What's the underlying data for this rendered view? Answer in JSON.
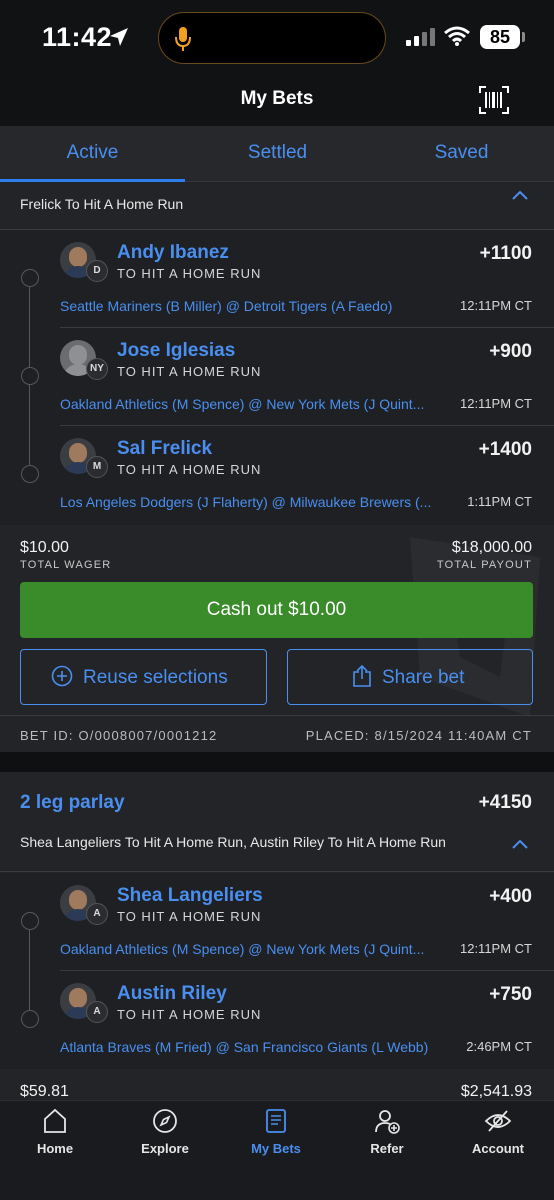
{
  "status": {
    "time": "11:42",
    "battery": "85"
  },
  "header": {
    "title": "My Bets"
  },
  "tabs": [
    {
      "label": "Active",
      "active": true
    },
    {
      "label": "Settled",
      "active": false
    },
    {
      "label": "Saved",
      "active": false
    }
  ],
  "bet1": {
    "description_tail": "Frelick To Hit A Home Run",
    "legs": [
      {
        "player": "Andy Ibanez",
        "market": "TO HIT A HOME RUN",
        "odds": "+1100",
        "team_logo": "D",
        "game": "Seattle Mariners (B Miller) @ Detroit Tigers (A Faedo)",
        "time": "12:11PM CT"
      },
      {
        "player": "Jose Iglesias",
        "market": "TO HIT A HOME RUN",
        "odds": "+900",
        "team_logo": "NY",
        "game": "Oakland Athletics (M Spence) @ New York Mets (J Quint...",
        "time": "12:11PM CT"
      },
      {
        "player": "Sal Frelick",
        "market": "TO HIT A HOME RUN",
        "odds": "+1400",
        "team_logo": "M",
        "game": "Los Angeles Dodgers (J Flaherty) @ Milwaukee Brewers (...",
        "time": "1:11PM CT"
      }
    ],
    "total_wager": "$10.00",
    "total_wager_label": "TOTAL WAGER",
    "total_payout": "$18,000.00",
    "total_payout_label": "TOTAL PAYOUT",
    "cashout_label": "Cash out $10.00",
    "reuse_label": "Reuse selections",
    "share_label": "Share bet",
    "bet_id": "BET ID: O/0008007/0001212",
    "placed": "PLACED: 8/15/2024 11:40AM CT"
  },
  "bet2": {
    "title": "2 leg parlay",
    "odds": "+4150",
    "description": "Shea Langeliers To Hit A Home Run, Austin Riley To Hit A Home Run",
    "legs": [
      {
        "player": "Shea Langeliers",
        "market": "TO HIT A HOME RUN",
        "odds": "+400",
        "team_logo": "A",
        "game": "Oakland Athletics (M Spence) @ New York Mets (J Quint...",
        "time": "12:11PM CT"
      },
      {
        "player": "Austin Riley",
        "market": "TO HIT A HOME RUN",
        "odds": "+750",
        "team_logo": "A",
        "game": "Atlanta Braves (M Fried) @ San Francisco Giants (L Webb)",
        "time": "2:46PM CT"
      }
    ],
    "total_wager": "$59.81",
    "total_payout": "$2,541.93"
  },
  "nav": [
    {
      "label": "Home",
      "icon": "home-icon"
    },
    {
      "label": "Explore",
      "icon": "compass-icon"
    },
    {
      "label": "My Bets",
      "icon": "betslip-icon",
      "active": true
    },
    {
      "label": "Refer",
      "icon": "refer-icon"
    },
    {
      "label": "Account",
      "icon": "account-icon"
    }
  ],
  "colors": {
    "accent": "#4a8ff0",
    "cashout": "#3a8c2a",
    "card": "#222427",
    "background": "#111214"
  }
}
